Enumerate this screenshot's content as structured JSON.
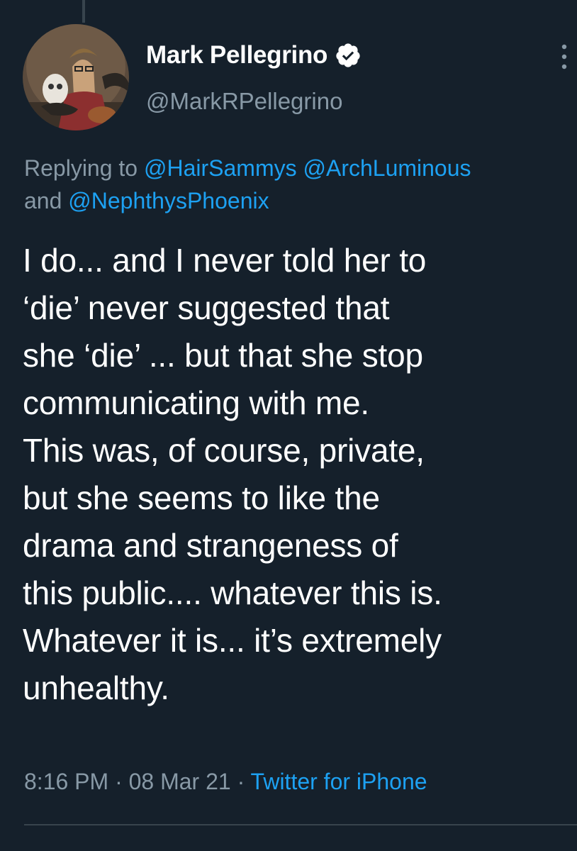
{
  "tweet": {
    "author": {
      "display_name": "Mark Pellegrino",
      "handle": "@MarkRPellegrino",
      "verified_icon": "verified-badge-icon",
      "avatar_icon": "profile-avatar"
    },
    "reply": {
      "prefix": "Replying to",
      "mentions": [
        "@HairSammys",
        "@ArchLuminous",
        "@NephthysPhoenix"
      ],
      "conjunction": "and"
    },
    "text_lines": [
      "I do... and I never told her to",
      "‘die’ never suggested that",
      "she ‘die’ ... but that she stop",
      "communicating with me.",
      "This was, of course, private,",
      "but she seems to like the",
      "drama and strangeness of",
      "this public.... whatever this is.",
      "Whatever it is... it’s extremely",
      "unhealthy."
    ],
    "meta": {
      "time": "8:16 PM",
      "separator": "·",
      "date": "08 Mar 21",
      "source": "Twitter for iPhone"
    },
    "more_icon": "more-vertical-icon"
  },
  "colors": {
    "background": "#15202b",
    "primary_text": "#ffffff",
    "secondary_text": "#8899a6",
    "accent": "#1da1f2",
    "divider": "#38444d"
  }
}
